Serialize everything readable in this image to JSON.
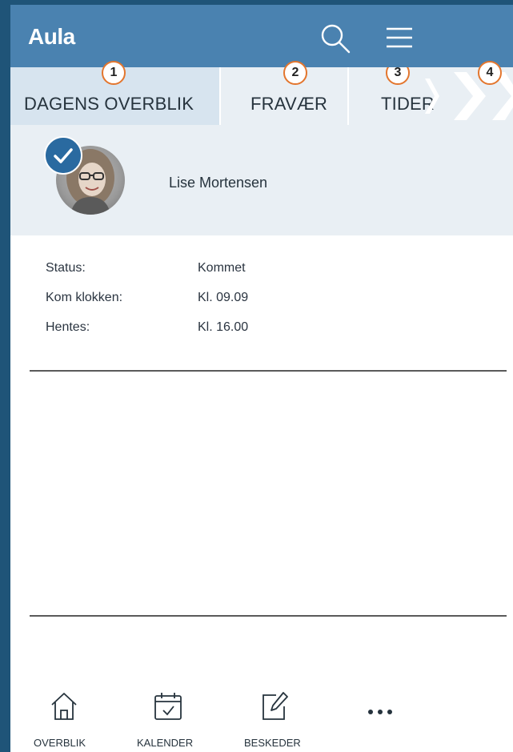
{
  "header": {
    "app_title": "Aula",
    "search_icon": "search-icon",
    "menu_icon": "hamburger-menu-icon",
    "background_color": "#4a82b0"
  },
  "tabs": [
    {
      "label": "DAGENS OVERBLIK",
      "number": "1",
      "active": true
    },
    {
      "label": "FRAVÆR",
      "number": "2",
      "active": false
    },
    {
      "label": "TIDER",
      "number": "3",
      "active": false
    }
  ],
  "extra_badge": "4",
  "badge_color": "#e3762e",
  "child": {
    "name": "Lise Mortensen",
    "checked_in": true
  },
  "info": [
    {
      "label": "Status:",
      "value": "Kommet"
    },
    {
      "label": "Kom klokken:",
      "value": "Kl. 09.09"
    },
    {
      "label": "Hentes:",
      "value": "Kl. 16.00"
    }
  ],
  "bottom_nav": [
    {
      "label": "OVERBLIK",
      "icon": "home-icon"
    },
    {
      "label": "KALENDER",
      "icon": "calendar-icon"
    },
    {
      "label": "BESKEDER",
      "icon": "compose-message-icon"
    },
    {
      "label": "",
      "icon": "more-icon"
    }
  ]
}
